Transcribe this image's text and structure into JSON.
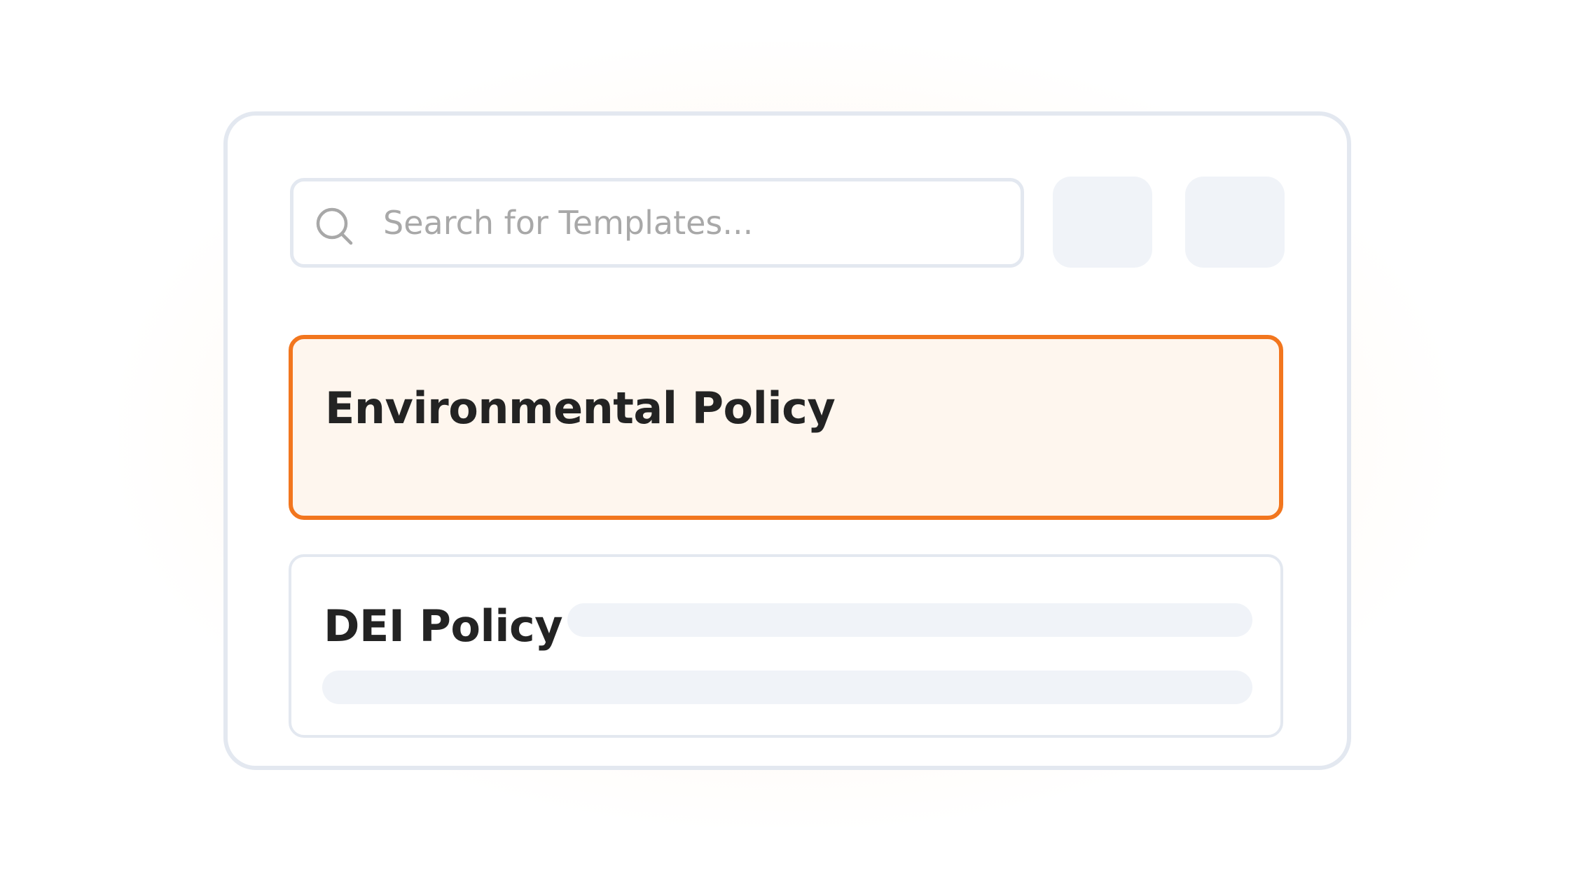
{
  "search": {
    "placeholder": "Search for Templates..."
  },
  "templates": [
    {
      "title": "Environmental Policy",
      "selected": true
    },
    {
      "title": "DEI Policy",
      "selected": false
    }
  ],
  "colors": {
    "accent": "#f2761e",
    "selected_bg": "#fef6ee",
    "border": "#e3e8f0",
    "skeleton": "#f0f3f8",
    "text": "#232323",
    "placeholder": "#a8a8a8"
  }
}
